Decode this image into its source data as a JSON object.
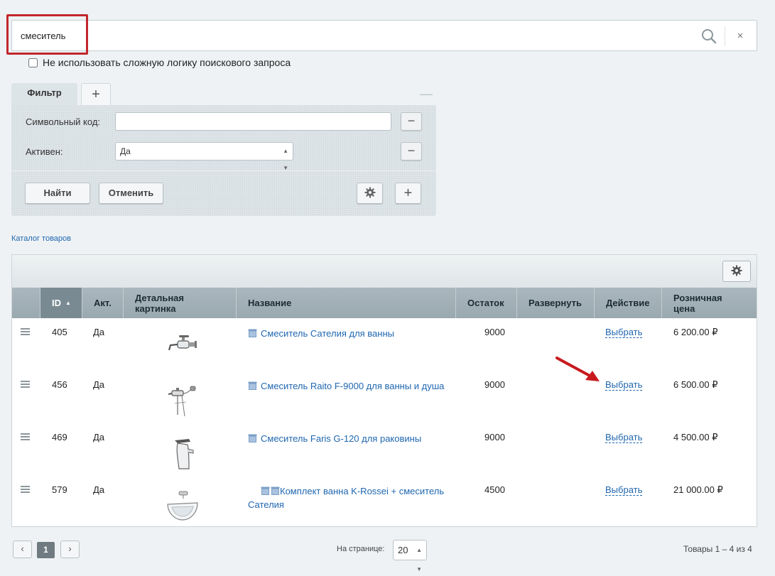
{
  "search": {
    "value": "смеситель",
    "logic_checkbox_label": "Не использовать сложную логику поискового запроса",
    "clear_symbol": "×"
  },
  "filter": {
    "tab_label": "Фильтр",
    "add_tab_symbol": "+",
    "collapse_symbol": "—",
    "fields": [
      {
        "label": "Символьный код:",
        "value": ""
      },
      {
        "label": "Активен:",
        "value": "Да"
      }
    ],
    "find_button": "Найти",
    "cancel_button": "Отменить",
    "remove_symbol": "−",
    "add_symbol": "+"
  },
  "breadcrumb": "Каталог товаров",
  "grid": {
    "columns": {
      "id": "ID",
      "active": "Акт.",
      "picture_line1": "Детальная",
      "picture_line2": "картинка",
      "name": "Название",
      "stock": "Остаток",
      "expand": "Развернуть",
      "action": "Действие",
      "price_line1": "Розничная",
      "price_line2": "цена"
    },
    "sorted_column": "id",
    "sort_direction": "asc",
    "rows": [
      {
        "id": "405",
        "active": "Да",
        "name": "Смеситель Сателия для ванны",
        "stock": "9000",
        "action": "Выбрать",
        "price": "6 200.00 ₽",
        "thumb": "bath-faucet-icon"
      },
      {
        "id": "456",
        "active": "Да",
        "name": "Смеситель Raito F-9000 для ванны и душа",
        "stock": "9000",
        "action": "Выбрать",
        "price": "6 500.00 ₽",
        "thumb": "shower-faucet-icon"
      },
      {
        "id": "469",
        "active": "Да",
        "name": "Смеситель Faris G-120 для раковины",
        "stock": "9000",
        "action": "Выбрать",
        "price": "4 500.00 ₽",
        "thumb": "sink-faucet-icon"
      },
      {
        "id": "579",
        "active": "Да",
        "name": "Комплект ванна K-Rossei + смеситель Сателия",
        "stock": "4500",
        "action": "Выбрать",
        "price": "21 000.00 ₽",
        "thumb": "bathtub-set-icon"
      }
    ]
  },
  "pagination": {
    "prev_symbol": "‹",
    "next_symbol": "›",
    "current_page": "1",
    "per_page_label": "На странице:",
    "per_page_value": "20",
    "total": "Товары 1 – 4 из 4"
  },
  "colors": {
    "accent_link": "#2067b0",
    "highlight_red": "#c1272d",
    "header_bg": "#9aa8af",
    "sorted_header_bg": "#7a8a92"
  }
}
